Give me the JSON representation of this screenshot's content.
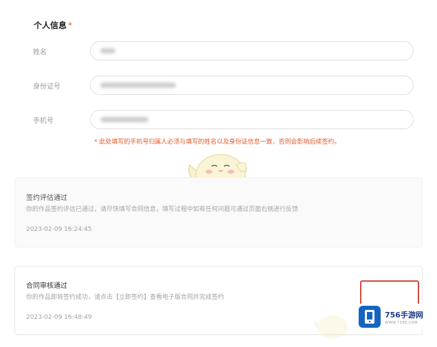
{
  "form": {
    "section_title": "个人信息",
    "required_mark": "*",
    "fields": [
      {
        "label": "姓名",
        "value": ""
      },
      {
        "label": "身份证号",
        "value": ""
      },
      {
        "label": "手机号",
        "value": ""
      }
    ],
    "notice": "* 此处填写的手机号归属人必须与填写的姓名以及身份证信息一致，否则会影响后续签约。"
  },
  "cards": [
    {
      "title": "签约评估通过",
      "desc": "你的作品签约评估已通过，请尽快填写合同信息，填写过程中如有任何问题可通过页面右侧进行反馈",
      "time": "2023-02-09 16:24:45"
    },
    {
      "title": "合同审核通过",
      "desc": "你的作品即将签约成功，请点击【立即签约】查看电子版合同并完成签约",
      "time": "2023-02-09 16:48:49"
    }
  ],
  "watermark": {
    "brand": "756手游网",
    "url": "WWW.7356.COM",
    "icon": "phone-icon"
  },
  "colors": {
    "accent": "#e0592a",
    "button_border": "#d24a41",
    "watermark_blue": "#1565c0"
  }
}
